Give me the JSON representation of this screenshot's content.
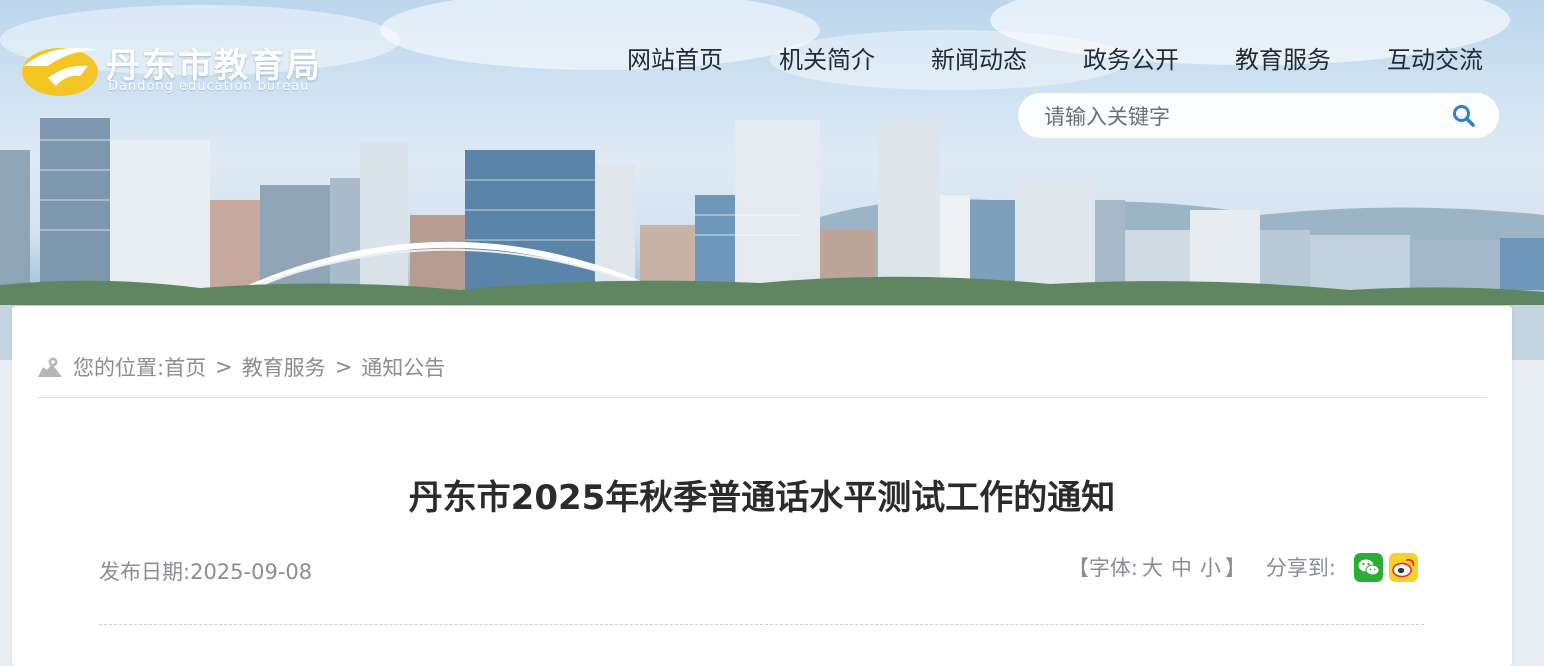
{
  "header": {
    "logo_cn": "丹东市教育局",
    "logo_en": "Dandong education bureau",
    "nav": [
      "网站首页",
      "机关简介",
      "新闻动态",
      "政务公开",
      "教育服务",
      "互动交流"
    ],
    "search_placeholder": "请输入关键字"
  },
  "breadcrumb": {
    "prefix": "您的位置:",
    "items": [
      "首页",
      "教育服务",
      "通知公告"
    ],
    "separator": ">"
  },
  "article": {
    "title": "丹东市2025年秋季普通话水平测试工作的通知",
    "date_label": "发布日期:",
    "date": "2025-09-08",
    "font_open": "【字体:",
    "font_large": "大",
    "font_medium": "中",
    "font_small": "小",
    "font_close": "】",
    "share_label": "分享到:"
  },
  "icons": {
    "search": "search-icon",
    "location": "location-map-icon",
    "wechat": "wechat-icon",
    "weibo": "weibo-icon"
  },
  "colors": {
    "nav_text": "#1f2b36",
    "meta_text": "#8a8d91",
    "title_text": "#2b2b2b",
    "wechat": "#2bae38",
    "weibo_bg": "#f5d12c",
    "weibo_red": "#e2272a",
    "logo_yellow": "#f3c623"
  }
}
